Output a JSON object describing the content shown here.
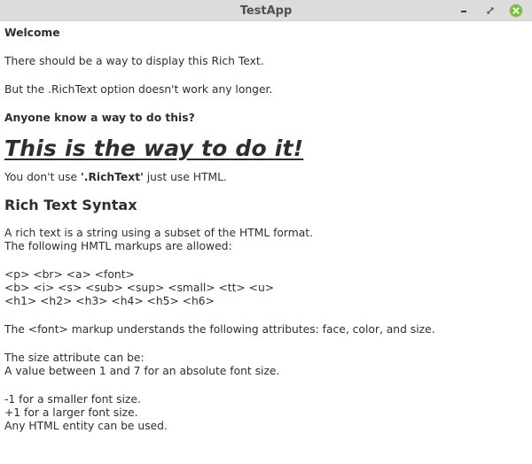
{
  "window": {
    "title": "TestApp",
    "minimize_icon": "minimize-icon",
    "maximize_icon": "maximize-icon",
    "close_icon": "close-icon",
    "close_color": "#7ebc45"
  },
  "content": {
    "welcome": "Welcome",
    "line1": "There should be a way to display this Rich Text.",
    "line2": "But the .RichText option doesn't work any longer.",
    "question": "Anyone know a way to do this?",
    "headline": "This is the way to do it!",
    "answer_prefix": "You don't use ",
    "answer_bold": "'.RichText'",
    "answer_suffix": " just use HTML.",
    "syntax_heading": "Rich Text Syntax",
    "syntax_line1": "A rich text is a string using a subset of the HTML format.",
    "syntax_line2": "The following HMTL markups are allowed:",
    "markups_line1": "<p> <br> <a> <font>",
    "markups_line2": "<b> <i> <s> <sub> <sup> <small> <tt> <u>",
    "markups_line3": "<h1> <h2> <h3> <h4> <h5> <h6>",
    "font_attrs": "The <font> markup understands the following attributes: face, color, and size.",
    "size_line1": "The size attribute can be:",
    "size_line2": "A value between 1 and 7 for an absolute font size.",
    "size_line3": "-1 for a smaller font size.",
    "size_line4": "+1 for a larger font size.",
    "size_line5": "Any HTML entity can be used."
  }
}
